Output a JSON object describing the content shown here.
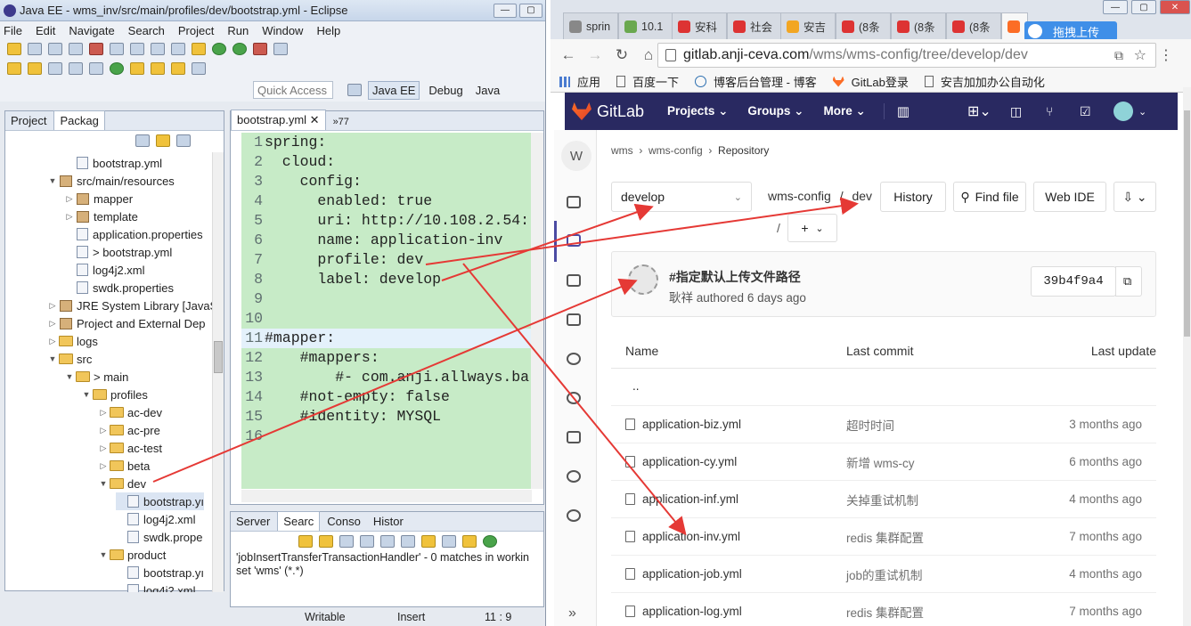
{
  "eclipse": {
    "title": "Java EE - wms_inv/src/main/profiles/dev/bootstrap.yml - Eclipse",
    "menu": [
      "File",
      "Edit",
      "Navigate",
      "Search",
      "Project",
      "Run",
      "Window",
      "Help"
    ],
    "quick_access": "Quick Access",
    "perspectives": [
      "Java EE",
      "Debug",
      "Java"
    ],
    "package_tabs": [
      "Project",
      "Packag"
    ],
    "tree": [
      {
        "label": "bootstrap.yml",
        "indent": 1,
        "type": "file"
      },
      {
        "label": "src/main/resources",
        "indent": 0,
        "type": "pkg",
        "arrow": "▼"
      },
      {
        "label": "mapper",
        "indent": 1,
        "type": "pkg",
        "arrow": "▷"
      },
      {
        "label": "template",
        "indent": 1,
        "type": "pkg",
        "arrow": "▷"
      },
      {
        "label": "application.properties",
        "indent": 1,
        "type": "file"
      },
      {
        "label": "> bootstrap.yml",
        "indent": 1,
        "type": "file"
      },
      {
        "label": "log4j2.xml",
        "indent": 1,
        "type": "file"
      },
      {
        "label": "swdk.properties",
        "indent": 1,
        "type": "file"
      },
      {
        "label": "JRE System Library [JavaS",
        "indent": 0,
        "type": "pkg",
        "arrow": "▷"
      },
      {
        "label": "Project and External Dep",
        "indent": 0,
        "type": "pkg",
        "arrow": "▷"
      },
      {
        "label": "logs",
        "indent": 0,
        "type": "folder",
        "arrow": "▷"
      },
      {
        "label": "src",
        "indent": 0,
        "type": "folder",
        "arrow": "▼"
      },
      {
        "label": "> main",
        "indent": 1,
        "type": "folder",
        "arrow": "▼"
      },
      {
        "label": "profiles",
        "indent": 2,
        "type": "folder",
        "arrow": "▼"
      },
      {
        "label": "ac-dev",
        "indent": 3,
        "type": "folder",
        "arrow": "▷"
      },
      {
        "label": "ac-pre",
        "indent": 3,
        "type": "folder",
        "arrow": "▷"
      },
      {
        "label": "ac-test",
        "indent": 3,
        "type": "folder",
        "arrow": "▷"
      },
      {
        "label": "beta",
        "indent": 3,
        "type": "folder",
        "arrow": "▷"
      },
      {
        "label": "dev",
        "indent": 3,
        "type": "folder",
        "arrow": "▼"
      },
      {
        "label": "bootstrap.yı",
        "indent": 4,
        "type": "file",
        "selected": true
      },
      {
        "label": "log4j2.xml",
        "indent": 4,
        "type": "file"
      },
      {
        "label": "swdk.prope",
        "indent": 4,
        "type": "file"
      },
      {
        "label": "product",
        "indent": 3,
        "type": "folder",
        "arrow": "▼"
      },
      {
        "label": "bootstrap.yı",
        "indent": 4,
        "type": "file"
      },
      {
        "label": "log4j2.xml",
        "indent": 4,
        "type": "file"
      }
    ],
    "editor_tab": "bootstrap.yml",
    "editor_tab_extra": "»77",
    "code": [
      {
        "n": "1",
        "t": "spring:"
      },
      {
        "n": "2",
        "t": "  cloud:"
      },
      {
        "n": "3",
        "t": "    config:"
      },
      {
        "n": "4",
        "t": "      enabled: true"
      },
      {
        "n": "5",
        "t": "      uri: http://10.108.2.54:"
      },
      {
        "n": "6",
        "t": "      name: application-inv"
      },
      {
        "n": "7",
        "t": "      profile: dev"
      },
      {
        "n": "8",
        "t": "      label: develop"
      },
      {
        "n": "9",
        "t": ""
      },
      {
        "n": "10",
        "t": ""
      },
      {
        "n": "11",
        "t": "#mapper:"
      },
      {
        "n": "12",
        "t": "    #mappers:"
      },
      {
        "n": "13",
        "t": "        #- com.anji.allways.ba"
      },
      {
        "n": "14",
        "t": "    #not-empty: false"
      },
      {
        "n": "15",
        "t": "    #identity: MYSQL"
      },
      {
        "n": "16",
        "t": ""
      }
    ],
    "bottom_tabs": [
      "Server",
      "Searc",
      "Conso",
      "Histor"
    ],
    "search_result": "'jobInsertTransferTransactionHandler' - 0 matches in workin",
    "search_result2": "set 'wms' (*.*)",
    "status": {
      "mode": "Writable",
      "insert": "Insert",
      "pos": "11 : 9"
    }
  },
  "chrome": {
    "tabs": [
      {
        "label": "sprin",
        "color": "#888"
      },
      {
        "label": "10.1",
        "color": "#6aa84f"
      },
      {
        "label": "安科",
        "color": "#d33"
      },
      {
        "label": "社会",
        "color": "#d33"
      },
      {
        "label": "安吉",
        "color": "#f2a623"
      },
      {
        "label": "(8条",
        "color": "#d33"
      },
      {
        "label": "(8条",
        "color": "#d33"
      },
      {
        "label": "(8条",
        "color": "#d33"
      },
      {
        "label": "",
        "color": "#fc6d26"
      }
    ],
    "baidu_button": "拖拽上传",
    "url_host": "gitlab.anji-ceva.com",
    "url_path": "/wms/wms-config/tree/develop/dev",
    "bookmarks": [
      "应用",
      "百度一下",
      "博客后台管理 - 博客",
      "GitLab登录",
      "安吉加加办公自动化"
    ]
  },
  "gitlab": {
    "brand": "GitLab",
    "nav": [
      "Projects",
      "Groups",
      "More"
    ],
    "breadcrumb": [
      "wms",
      "wms-config",
      "Repository"
    ],
    "avatar_letter": "W",
    "branch": "develop",
    "path_root": "wms-config",
    "path_sep": "/",
    "path_dir": "dev",
    "path_sep2": "/",
    "add": "+",
    "history": "History",
    "find_file": "Find file",
    "web_ide": "Web IDE",
    "commit": {
      "message": "#指定默认上传文件路径",
      "author": "耿祥",
      "authored": "authored",
      "time": "6 days ago",
      "sha": "39b4f9a4"
    },
    "table_headers": [
      "Name",
      "Last commit",
      "Last update"
    ],
    "parent": "..",
    "files": [
      {
        "name": "application-biz.yml",
        "commit": "超时时间",
        "updated": "3 months ago"
      },
      {
        "name": "application-cy.yml",
        "commit": "新增 wms-cy",
        "updated": "6 months ago"
      },
      {
        "name": "application-inf.yml",
        "commit": "关掉重试机制",
        "updated": "4 months ago"
      },
      {
        "name": "application-inv.yml",
        "commit": "redis 集群配置",
        "updated": "7 months ago"
      },
      {
        "name": "application-job.yml",
        "commit": "job的重试机制",
        "updated": "4 months ago"
      },
      {
        "name": "application-log.yml",
        "commit": "redis 集群配置",
        "updated": "7 months ago"
      }
    ],
    "arrow_color": "#e53935"
  }
}
